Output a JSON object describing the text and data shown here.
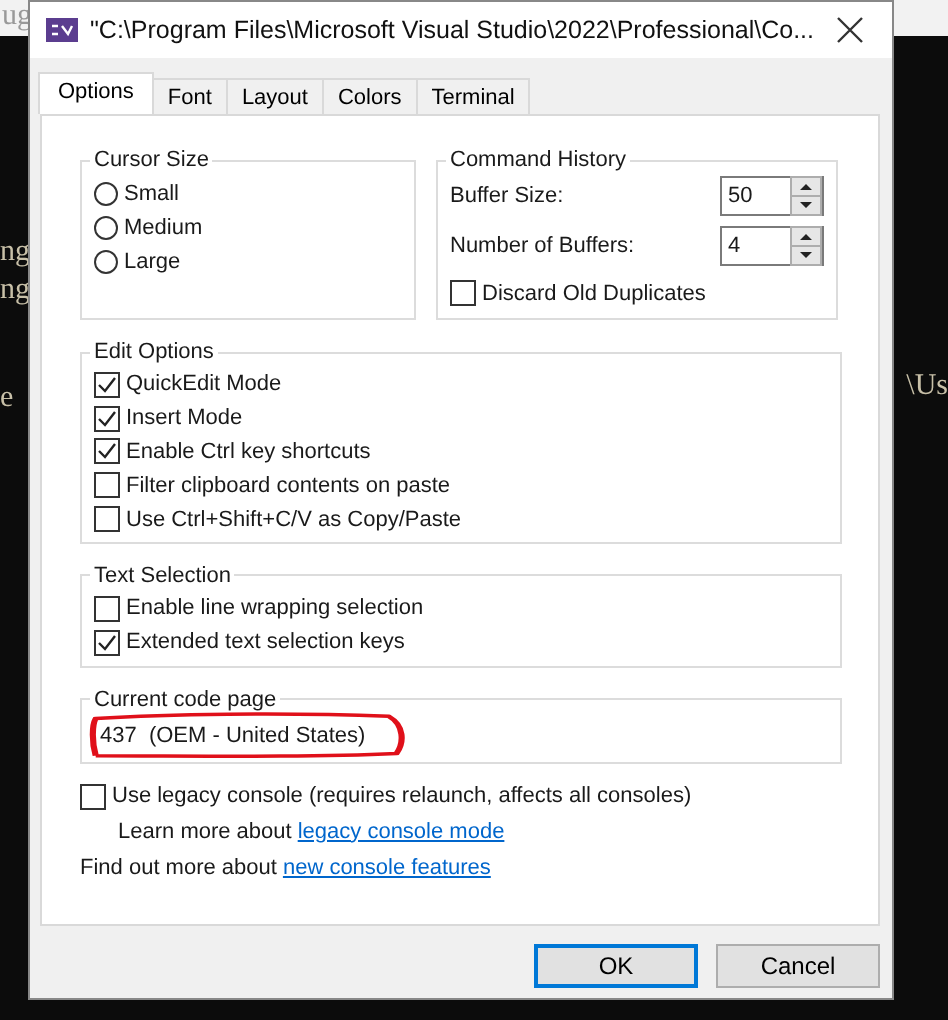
{
  "background": {
    "top_text": "ug",
    "left_lines": [
      "ng",
      "ng",
      "e"
    ],
    "right_lines": [
      "\\Us"
    ]
  },
  "window": {
    "title": "\"C:\\Program Files\\Microsoft Visual Studio\\2022\\Professional\\Co..."
  },
  "tabs": [
    {
      "label": "Options",
      "selected": true
    },
    {
      "label": "Font",
      "selected": false
    },
    {
      "label": "Layout",
      "selected": false
    },
    {
      "label": "Colors",
      "selected": false
    },
    {
      "label": "Terminal",
      "selected": false
    }
  ],
  "cursor_size": {
    "title": "Cursor Size",
    "options": [
      {
        "label": "Small",
        "selected": false
      },
      {
        "label": "Medium",
        "selected": false
      },
      {
        "label": "Large",
        "selected": false
      }
    ]
  },
  "command_history": {
    "title": "Command History",
    "fields": [
      {
        "label": "Buffer Size:",
        "value": "50"
      },
      {
        "label": "Number of Buffers:",
        "value": "4"
      }
    ],
    "discard": {
      "label": "Discard Old Duplicates",
      "checked": false
    }
  },
  "edit_options": {
    "title": "Edit Options",
    "items": [
      {
        "label": "QuickEdit Mode",
        "checked": true
      },
      {
        "label": "Insert Mode",
        "checked": true
      },
      {
        "label": "Enable Ctrl key shortcuts",
        "checked": true
      },
      {
        "label": "Filter clipboard contents on paste",
        "checked": false
      },
      {
        "label": "Use Ctrl+Shift+C/V as Copy/Paste",
        "checked": false
      }
    ]
  },
  "text_selection": {
    "title": "Text Selection",
    "items": [
      {
        "label": "Enable line wrapping selection",
        "checked": false
      },
      {
        "label": "Extended text selection keys",
        "checked": true
      }
    ]
  },
  "code_page": {
    "title": "Current code page",
    "value": "437  (OEM - United States)"
  },
  "legacy": {
    "label": "Use legacy console (requires relaunch, affects all consoles)",
    "checked": false,
    "note": "Learn more about",
    "link": "legacy console mode"
  },
  "more": {
    "text": "Find out more about",
    "link": "new console features"
  },
  "buttons": [
    {
      "label": "OK",
      "default": true
    },
    {
      "label": "Cancel",
      "default": false
    }
  ]
}
